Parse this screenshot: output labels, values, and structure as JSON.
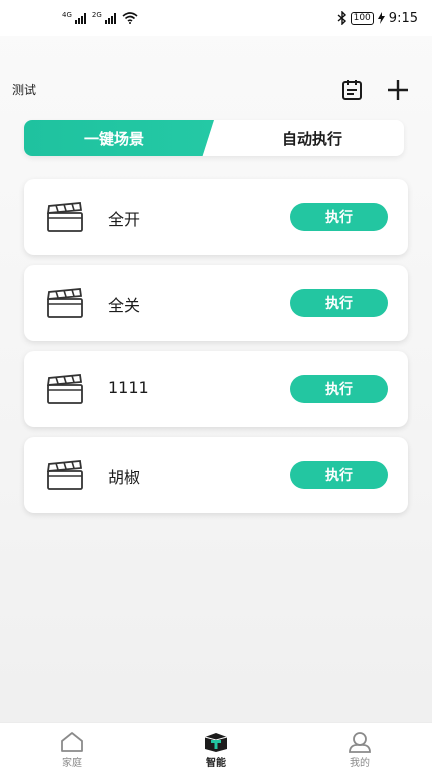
{
  "status_bar": {
    "signal1_tag": "4G",
    "signal2_tag": "2G",
    "battery": "100",
    "time": "9:15"
  },
  "header": {
    "title": "测试",
    "icons": [
      "notes-icon",
      "plus-icon"
    ]
  },
  "tabs": [
    {
      "label": "一键场景",
      "active": true
    },
    {
      "label": "自动执行",
      "active": false
    }
  ],
  "accent_color": "#23c6a1",
  "scenes": [
    {
      "name": "全开",
      "action_label": "执行"
    },
    {
      "name": "全关",
      "action_label": "执行"
    },
    {
      "name": "1111",
      "action_label": "执行"
    },
    {
      "name": "胡椒",
      "action_label": "执行"
    }
  ],
  "bottom_nav": [
    {
      "label": "家庭",
      "icon": "home-icon",
      "active": false
    },
    {
      "label": "智能",
      "icon": "smart-box-icon",
      "active": true
    },
    {
      "label": "我的",
      "icon": "profile-icon",
      "active": false
    }
  ]
}
